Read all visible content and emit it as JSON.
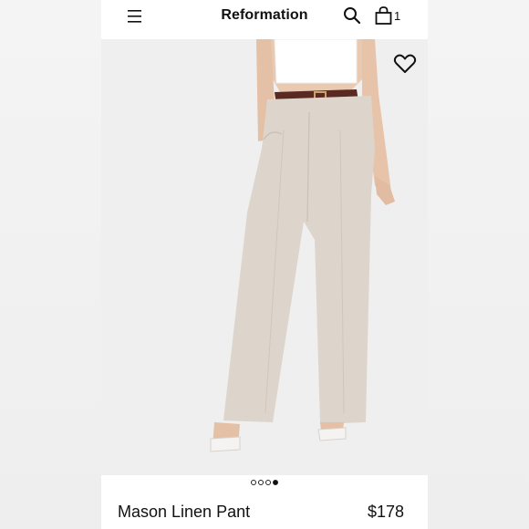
{
  "header": {
    "brand": "Reformation",
    "cart_count": "1"
  },
  "product": {
    "name": "Mason Linen Pant",
    "price": "$178",
    "image_count": 4,
    "active_image": 4
  },
  "colors": {
    "background": "#ffffff",
    "text": "#111111",
    "pant": "#ddd5cc",
    "belt": "#5a2a22"
  },
  "icons": {
    "menu": "hamburger-icon",
    "search": "search-icon",
    "bag": "shopping-bag-icon",
    "wishlist": "heart-icon"
  }
}
